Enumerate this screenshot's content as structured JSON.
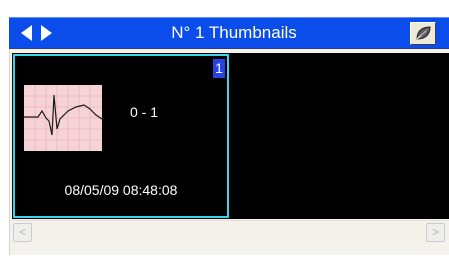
{
  "window": {
    "title": "N° 1 Thumbnails",
    "nav_prev_icon": "triangle-left",
    "nav_next_icon": "triangle-right",
    "corner_button_icon": "leaf-icon"
  },
  "thumbnail": {
    "index": "1",
    "range": "0 - 1",
    "timestamp": "08/05/09 08:48:08",
    "preview_icon": "ecg-waveform"
  },
  "scrollbar": {
    "left_arrow": "<",
    "right_arrow": ">"
  },
  "colors": {
    "titlebar": "#0b4dea",
    "thumb_border": "#39d5ee",
    "index_badge": "#2742e6",
    "ecg_background": "#f6d3d6"
  }
}
